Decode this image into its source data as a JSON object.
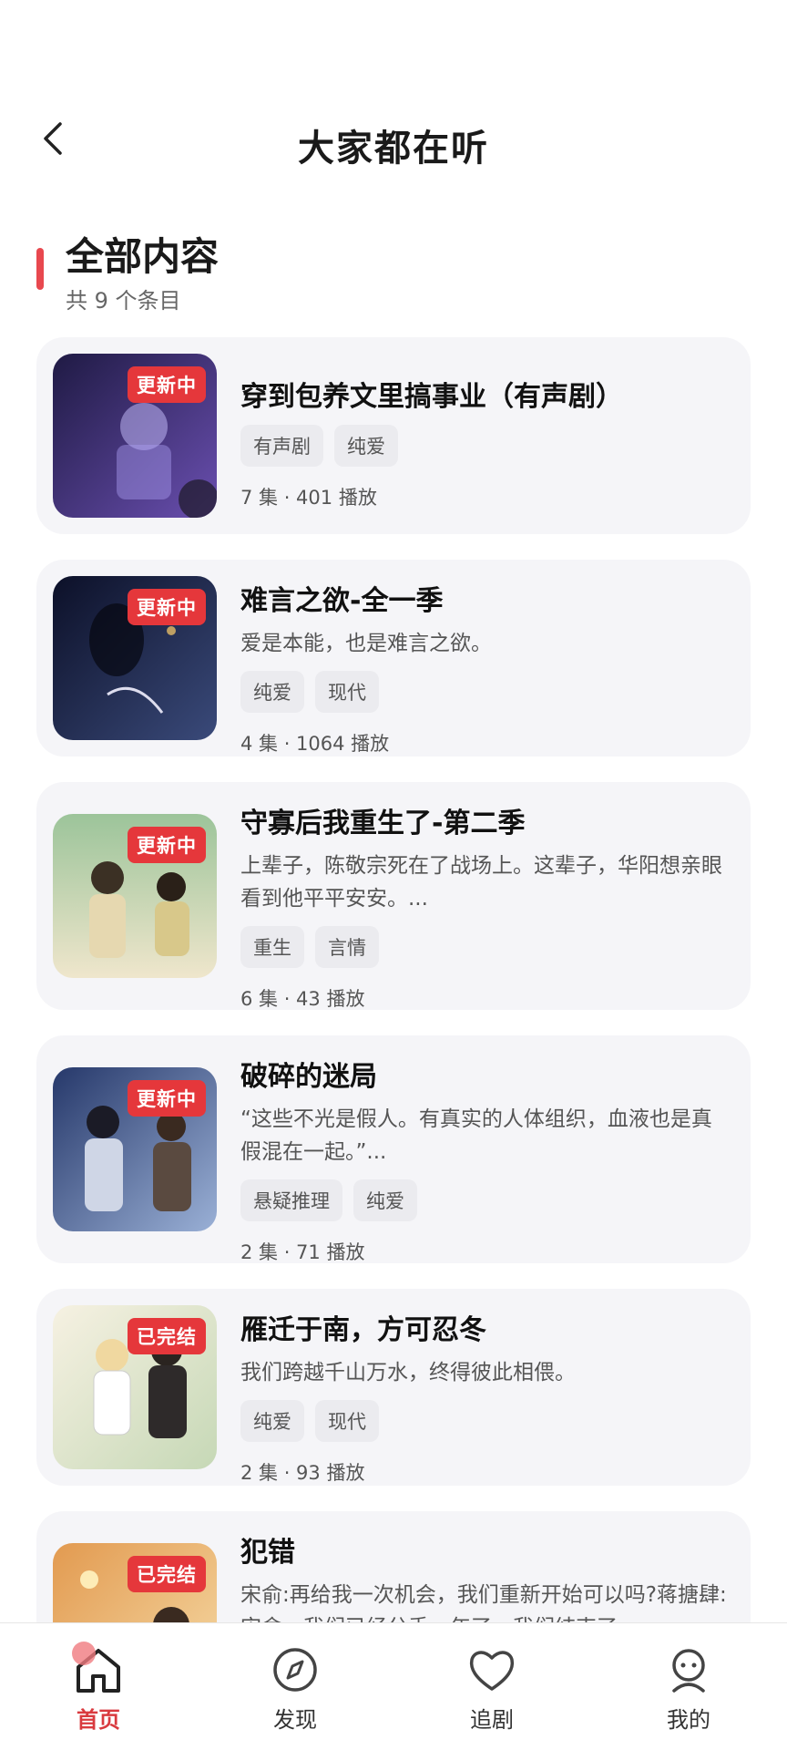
{
  "header": {
    "title": "大家都在听"
  },
  "section": {
    "title": "全部内容",
    "count": "共 9 个条目"
  },
  "items": [
    {
      "badge": "更新中",
      "title": "穿到包养文里搞事业（有声剧）",
      "desc": "",
      "tags": [
        "有声剧",
        "纯爱"
      ],
      "meta": "7 集 · 401 播放",
      "cover_colors": [
        "#2a2350",
        "#6a4fb0"
      ]
    },
    {
      "badge": "更新中",
      "title": "难言之欲-全一季",
      "desc": "爱是本能，也是难言之欲。",
      "tags": [
        "纯爱",
        "现代"
      ],
      "meta": "4 集 · 1064 播放",
      "cover_colors": [
        "#0f1430",
        "#3a4a7a"
      ]
    },
    {
      "badge": "更新中",
      "title": "守寡后我重生了-第二季",
      "desc": "上辈子，陈敬宗死在了战场上。这辈子，华阳想亲眼看到他平平安安。...",
      "tags": [
        "重生",
        "言情"
      ],
      "meta": "6 集 · 43 播放",
      "cover_colors": [
        "#a9c89a",
        "#e8e0c8"
      ]
    },
    {
      "badge": "更新中",
      "title": "破碎的迷局",
      "desc": "“这些不光是假人。有真实的人体组织，血液也是真假混在一起。”...",
      "tags": [
        "悬疑推理",
        "纯爱"
      ],
      "meta": "2 集 · 71 播放",
      "cover_colors": [
        "#2c3f6e",
        "#8aa0c8"
      ]
    },
    {
      "badge": "已完结",
      "title": "雁迁于南，方可忍冬",
      "desc": "我们跨越千山万水，终得彼此相偎。",
      "tags": [
        "纯爱",
        "现代"
      ],
      "meta": "2 集 · 93 播放",
      "cover_colors": [
        "#f4efe0",
        "#c8d8b8"
      ]
    },
    {
      "badge": "已完结",
      "title": "犯错",
      "desc": "宋俞:再给我一次机会，我们重新开始可以吗?蒋搪肆:宋俞，我们已经分手一年了，我们结束了。",
      "tags": [],
      "meta": "",
      "cover_colors": [
        "#e8a860",
        "#f4d8a0"
      ]
    }
  ],
  "nav": [
    {
      "label": "首页",
      "icon": "home-icon",
      "active": true
    },
    {
      "label": "发现",
      "icon": "compass-icon",
      "active": false
    },
    {
      "label": "追剧",
      "icon": "heart-icon",
      "active": false
    },
    {
      "label": "我的",
      "icon": "profile-icon",
      "active": false
    }
  ],
  "colors": {
    "accent": "#e5373b",
    "card_bg": "#f5f5f8",
    "tag_bg": "#ebebef"
  }
}
